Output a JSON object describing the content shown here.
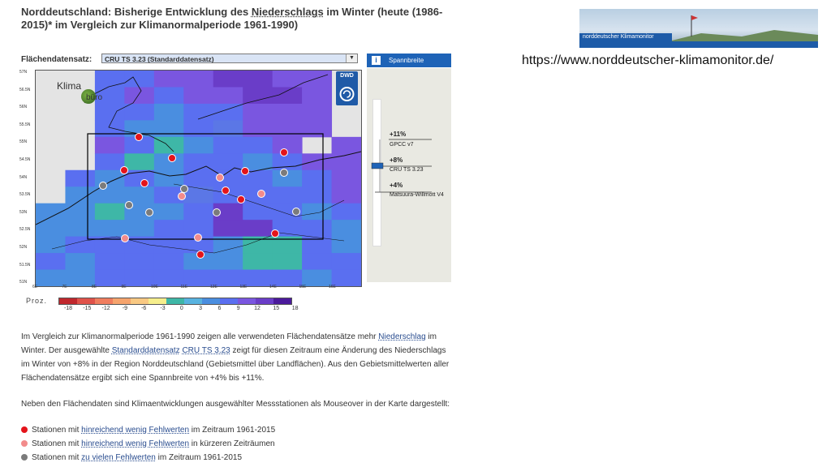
{
  "page": {
    "title_parts": [
      "Norddeutschland: Bisherige Entwicklung des ",
      "Niederschlags",
      " im Winter (heute (1986-2015)* im Vergleich zur Klimanormalperiode 1961-1990)"
    ],
    "dataset_label": "Flächendatensatz:",
    "dataset_selected": "CRU TS 3.23   (Standarddatensatz)",
    "source_url": "https://www.norddeutscher-klimamonitor.de/",
    "banner_text": "norddeutscher Klimamonitor"
  },
  "map": {
    "logo_top": "Klima",
    "logo_bottom": "büro",
    "dwd_label": "DWD",
    "lat_labels": [
      "57N",
      "56.5N",
      "56N",
      "55.5N",
      "55N",
      "54.5N",
      "54N",
      "53.5N",
      "53N",
      "52.5N",
      "52N",
      "51.5N",
      "51N"
    ],
    "lon_labels": [
      "6E",
      "7E",
      "8E",
      "9E",
      "10E",
      "11E",
      "12E",
      "13E",
      "14E",
      "15E",
      "16E"
    ],
    "colors": {
      "border": "#111111",
      "region_box": "#000000"
    },
    "stations_good": [
      [
        170,
        168
      ],
      [
        211,
        194
      ],
      [
        152,
        209
      ],
      [
        177,
        225
      ],
      [
        301,
        210
      ],
      [
        277,
        234
      ],
      [
        296,
        245
      ],
      [
        349,
        187
      ],
      [
        338,
        287
      ],
      [
        246,
        313
      ]
    ],
    "stations_short": [
      [
        270,
        218
      ],
      [
        223,
        241
      ],
      [
        321,
        238
      ],
      [
        153,
        293
      ],
      [
        243,
        292
      ]
    ],
    "stations_gaps": [
      [
        126,
        228
      ],
      [
        158,
        252
      ],
      [
        183,
        261
      ],
      [
        226,
        232
      ],
      [
        349,
        212
      ],
      [
        266,
        261
      ],
      [
        364,
        260
      ]
    ]
  },
  "info": {
    "header": "Spannbreite",
    "ranges": [
      {
        "value": "+11%",
        "source": "GPCC v7"
      },
      {
        "value": "+8%",
        "source": "CRU TS 3.23"
      },
      {
        "value": "+4%",
        "source": "Matsuura-Willmott V4"
      }
    ]
  },
  "legend": {
    "title": "Proz.",
    "ticks": [
      "-18",
      "-15",
      "-12",
      "-9",
      "-6",
      "-3",
      "0",
      "3",
      "6",
      "9",
      "12",
      "15",
      "18"
    ],
    "colors": [
      "#c0272d",
      "#e0524a",
      "#f07d5e",
      "#f6a46d",
      "#f9c983",
      "#f6ee8c",
      "#3eb7a7",
      "#58b3e0",
      "#4a8ee0",
      "#5a6ff0",
      "#7a56e0",
      "#6a3dc8",
      "#4b1a9c"
    ]
  },
  "text": {
    "p1": [
      {
        "t": "Im Vergleich zur Klimanormalperiode 1961-1990 zeigen alle verwendeten Flächendatensätze mehr "
      },
      {
        "t": "Niederschlag",
        "link": true
      },
      {
        "t": " im Winter. Der ausgewählte "
      },
      {
        "t": "Standarddatensatz",
        "link": true
      },
      {
        "t": " "
      },
      {
        "t": "CRU TS 3.23",
        "link": true
      },
      {
        "t": " zeigt für diesen Zeitraum eine Änderung des Niederschlags im Winter von +8% in der Region Norddeutschland (Gebietsmittel über Landflächen). Aus den Gebietsmittelwerten aller Flächendatensätze ergibt sich eine Spannbreite von +4% bis +11%."
      }
    ],
    "p2": "Neben den Flächendaten sind Klimaentwicklungen ausgewählter Messstationen als Mouseover in der Karte dargestellt:",
    "bullets": [
      {
        "color": "#e4141b",
        "pre": "Stationen mit ",
        "link": "hinreichend wenig Fehlwerten",
        "post": " im Zeitraum 1961-2015"
      },
      {
        "color": "#f28b8b",
        "pre": "Stationen mit ",
        "link": "hinreichend wenig Fehlwerten",
        "post": " in kürzeren Zeiträumen"
      },
      {
        "color": "#7b7b7b",
        "pre": "Stationen mit ",
        "link": "zu vielen Fehlwerten",
        "post": " im Zeitraum 1961-2015"
      }
    ]
  }
}
